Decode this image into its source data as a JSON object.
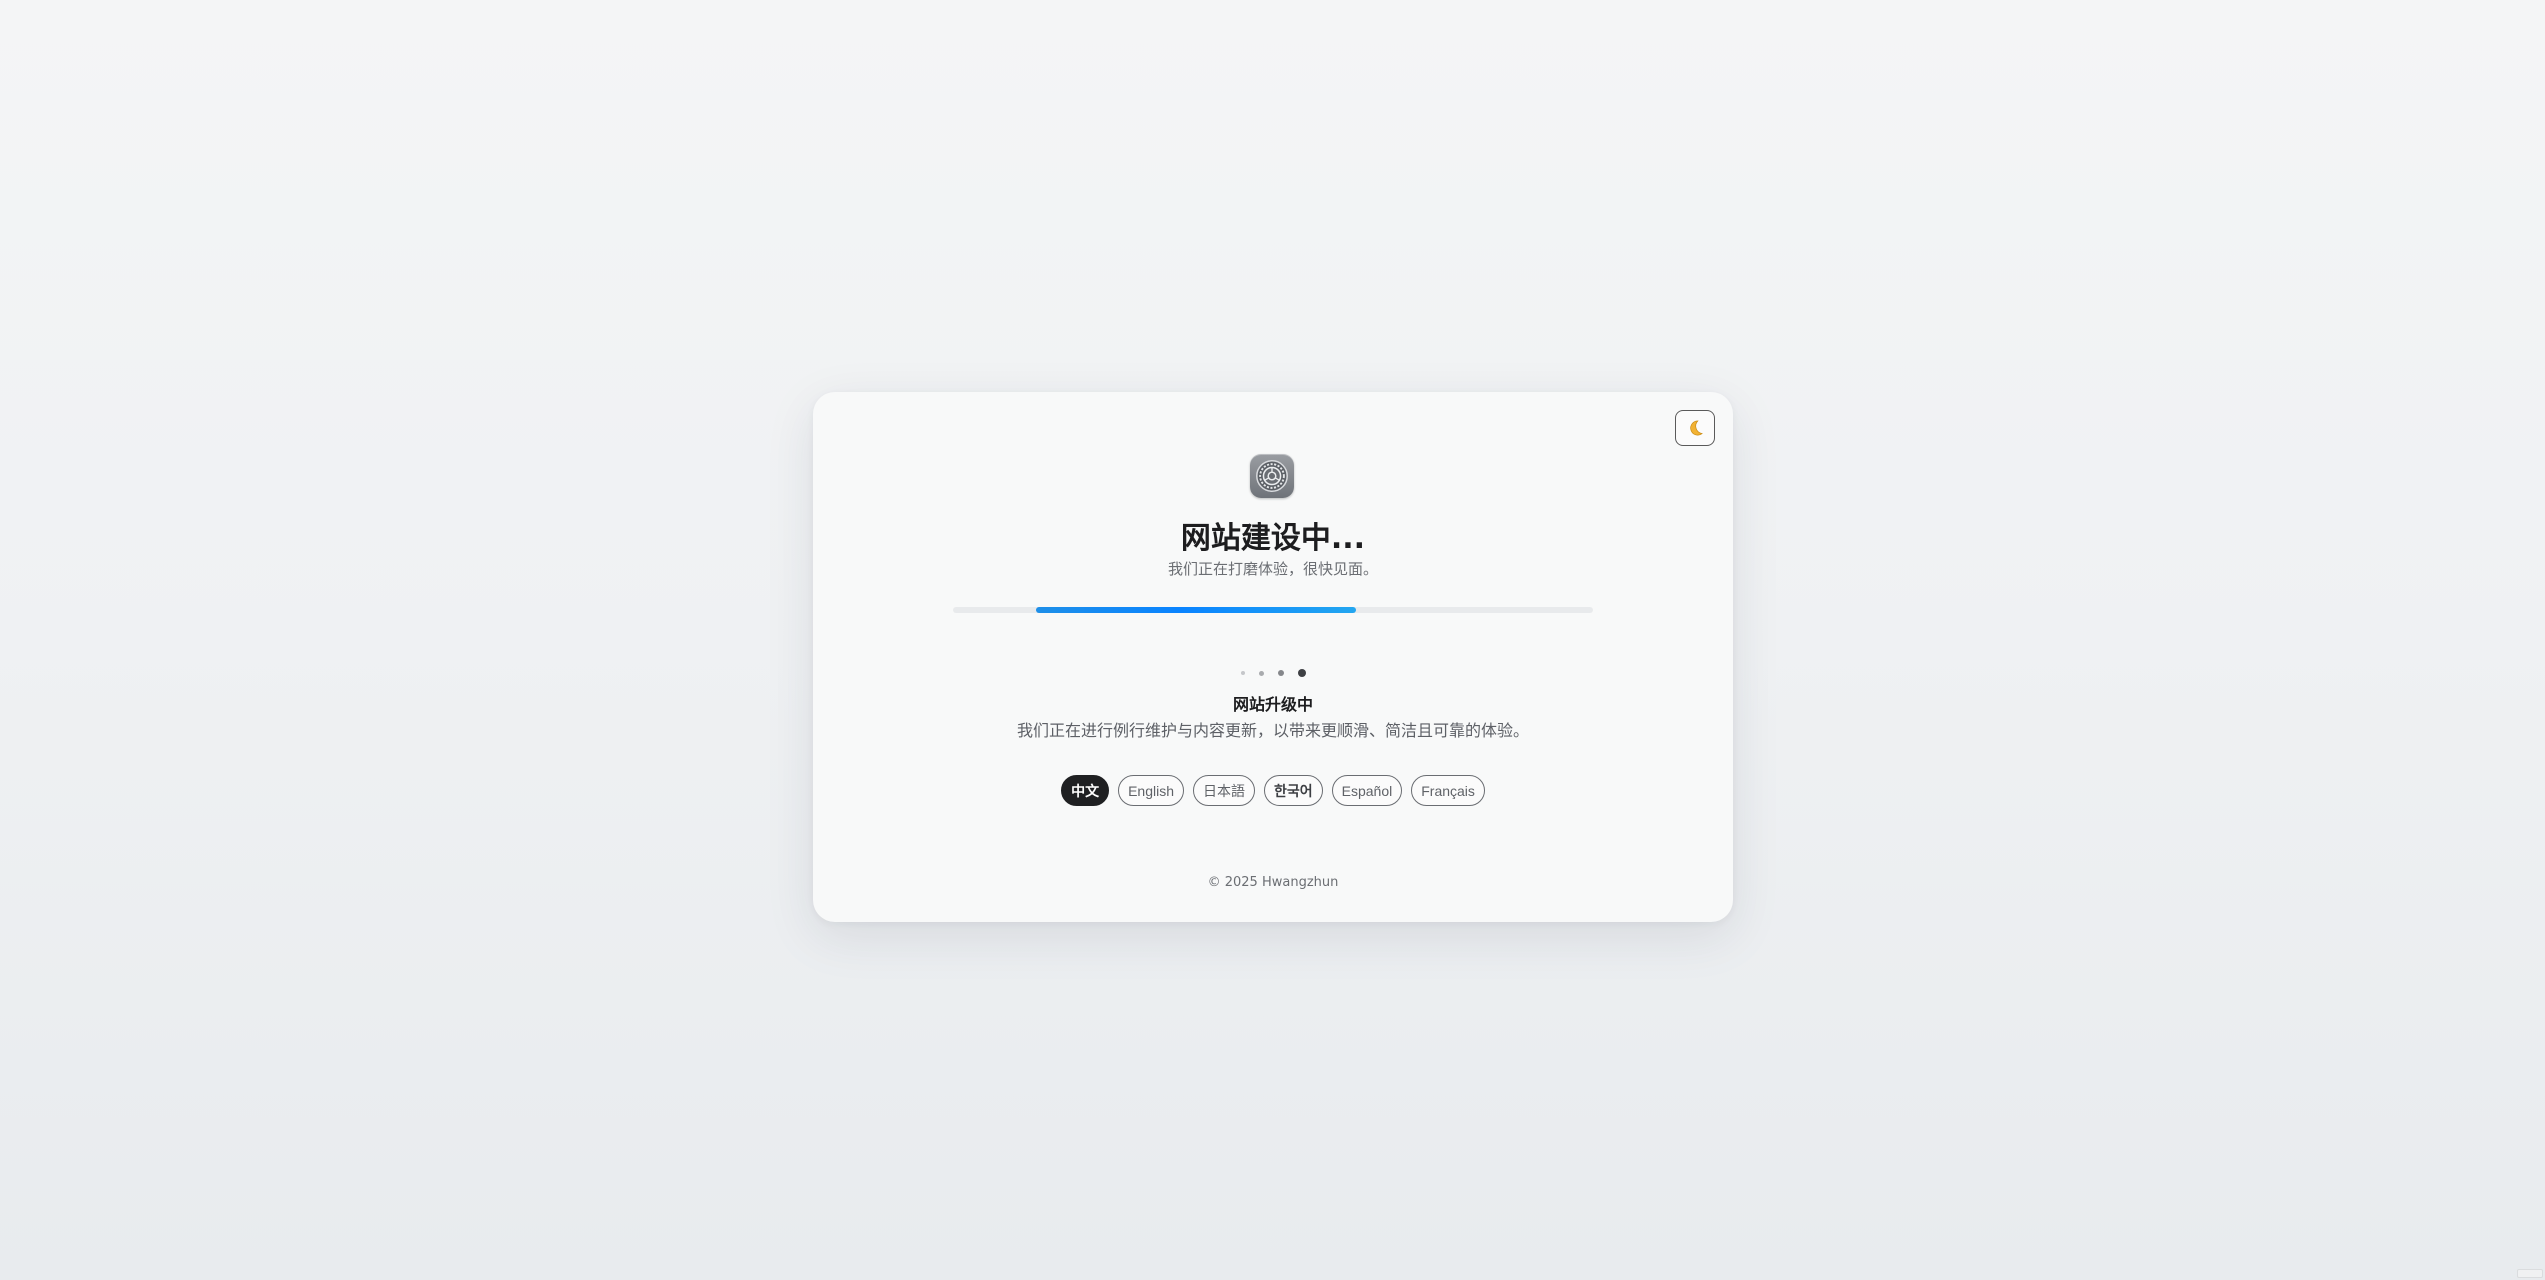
{
  "page": {
    "title": "网站建设中...",
    "subtitle": "我们正在打磨体验，很快见面。"
  },
  "theme_toggle": {
    "icon": "moon-icon",
    "label": ""
  },
  "app_icon": {
    "icon": "settings-gear-icon"
  },
  "progress": {
    "start_fraction": 0.13,
    "end_fraction": 0.63,
    "color": "#0a84ff"
  },
  "carousel": {
    "count": 4,
    "active_index": 3
  },
  "status": {
    "heading": "网站升级中",
    "description": "我们正在进行例行维护与内容更新，以带来更顺滑、简洁且可靠的体验。"
  },
  "languages": [
    {
      "label": "中文",
      "active": true
    },
    {
      "label": "English",
      "active": false
    },
    {
      "label": "日本語",
      "active": false
    },
    {
      "label": "한국어",
      "active": false
    },
    {
      "label": "Español",
      "active": false
    },
    {
      "label": "Français",
      "active": false
    }
  ],
  "footer": {
    "copyright": "© 2025 Hwangzhun"
  },
  "colors": {
    "background": "#eff1f3",
    "card": "#f8f9f9",
    "accent": "#0a84ff",
    "active_pill": "#1f2022"
  }
}
